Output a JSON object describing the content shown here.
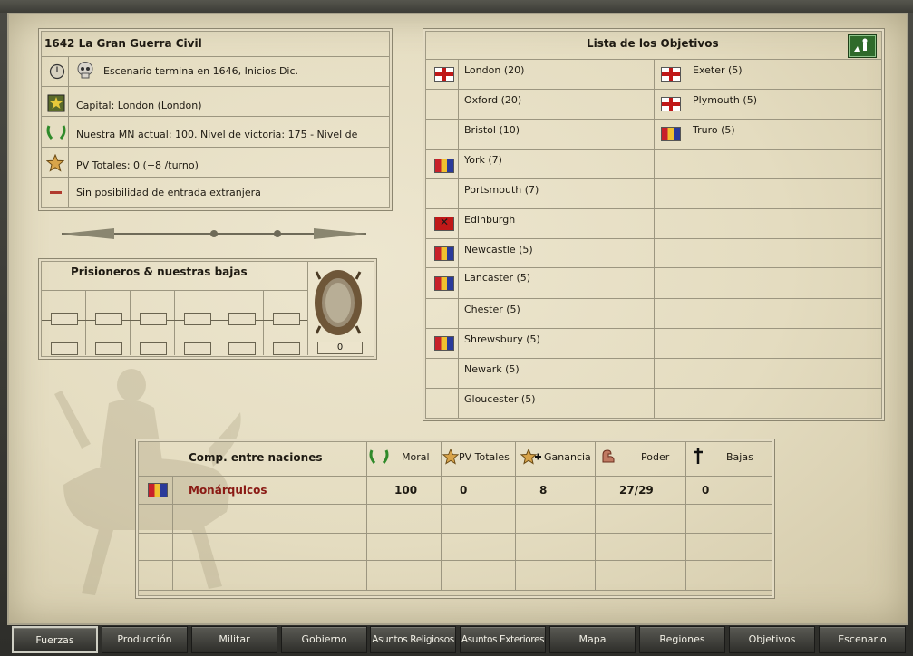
{
  "scenario": {
    "title": "1642 La Gran Guerra Civil",
    "end_text": "Escenario termina en 1646, Inicios Dic.",
    "capital": "Capital: London (London)",
    "morale": "Nuestra MN actual: 100. Nivel de victoria: 175 - Nivel de",
    "vp": "PV Totales: 0 (+8 /turno)",
    "foreign": "Sin posibilidad de entrada extranjera"
  },
  "prisoners": {
    "title": "Prisioneros & nuestras bajas",
    "count": "0"
  },
  "objectives": {
    "title": "Lista de los Objetivos",
    "left": [
      {
        "name": "London (20)",
        "flag": "eng"
      },
      {
        "name": "Oxford (20)",
        "flag": ""
      },
      {
        "name": "Bristol (10)",
        "flag": ""
      },
      {
        "name": "York (7)",
        "flag": "roy"
      },
      {
        "name": "Portsmouth (7)",
        "flag": ""
      },
      {
        "name": "Edinburgh",
        "flag": "sco"
      },
      {
        "name": "Newcastle (5)",
        "flag": "roy"
      },
      {
        "name": "Lancaster (5)",
        "flag": "roy"
      },
      {
        "name": "Chester (5)",
        "flag": ""
      },
      {
        "name": "Shrewsbury (5)",
        "flag": "roy"
      },
      {
        "name": "Newark (5)",
        "flag": ""
      },
      {
        "name": "Gloucester (5)",
        "flag": ""
      }
    ],
    "right": [
      {
        "name": "Exeter (5)",
        "flag": "eng"
      },
      {
        "name": "Plymouth (5)",
        "flag": "eng"
      },
      {
        "name": "Truro (5)",
        "flag": "roy"
      }
    ]
  },
  "comparison": {
    "title": "Comp. entre naciones",
    "headers": {
      "moral": "Moral",
      "vp": "PV Totales",
      "gain": "Ganancia",
      "power": "Poder",
      "losses": "Bajas"
    },
    "rows": [
      {
        "nation": "Monárquicos",
        "moral": "100",
        "vp": "0",
        "gain": "8",
        "power": "27/29",
        "losses": "0"
      }
    ]
  },
  "tabs": [
    "Fuerzas",
    "Producción",
    "Militar",
    "Gobierno",
    "Asuntos Religiosos",
    "Asuntos Exteriores",
    "Mapa",
    "Regiones",
    "Objetivos",
    "Escenario"
  ],
  "colors": {
    "nation": "#8a1a14",
    "parchment": "#e4dcc0"
  }
}
